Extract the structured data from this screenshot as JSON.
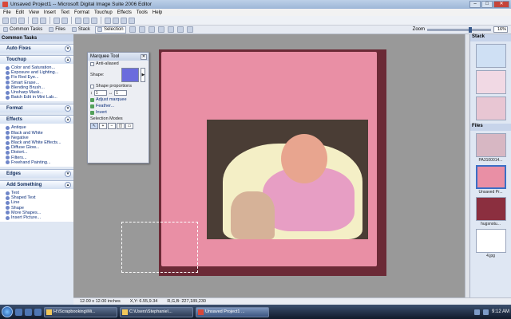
{
  "window": {
    "title": "Unsaved Project1 -- Microsoft Digital Image Suite 2006 Editor",
    "min": "–",
    "max": "□",
    "close": "✕"
  },
  "menu": [
    "File",
    "Edit",
    "View",
    "Insert",
    "Text",
    "Format",
    "Touchup",
    "Effects",
    "Tools",
    "Help"
  ],
  "pane_tabs": {
    "common_tasks": "Common Tasks",
    "files": "Files",
    "stack": "Stack",
    "selection": "Selection"
  },
  "zoom": {
    "label": "Zoom",
    "value": "16%"
  },
  "left_pane": {
    "header": "Common Tasks",
    "sections": [
      {
        "title": "Auto Fixes",
        "items": []
      },
      {
        "title": "Touchup",
        "items": [
          "Color and Saturation...",
          "Exposure and Lighting...",
          "Fix Red Eye...",
          "Smart Erase...",
          "Blending Brush...",
          "Unsharp Mask...",
          "Batch Edit in Mini Lab..."
        ]
      },
      {
        "title": "Format",
        "items": []
      },
      {
        "title": "Effects",
        "items": [
          "Antique",
          "Black and White",
          "Negative",
          "Black and White Effects...",
          "Diffuse Glow...",
          "Distort...",
          "Filters...",
          "Freehand Painting..."
        ]
      },
      {
        "title": "Edges",
        "items": []
      },
      {
        "title": "Add Something",
        "items": [
          "Text",
          "Shaped Text",
          "Line",
          "Shape",
          "More Shapes...",
          "Insert Picture..."
        ]
      }
    ]
  },
  "marquee_panel": {
    "title": "Marquee Tool",
    "anti_aliased": "Anti-aliased",
    "shape_label": "Shape:",
    "shape_proportions": "Shape proportions",
    "width_value": "1",
    "height_value": "1",
    "adjust_marquee": "Adjust marquee",
    "feather": "Feather...",
    "invert": "Invert",
    "selection_modes": "Selection Modes"
  },
  "right_pane": {
    "stack_header": "Stack",
    "files_header": "Files",
    "files": [
      {
        "label": "PA3100014..."
      },
      {
        "label": "Unsaved Pr..."
      },
      {
        "label": "hugsnotu..."
      },
      {
        "label": "4.jpg"
      }
    ]
  },
  "status": {
    "size": "12.00 x 12.00 inches",
    "xy": "X,Y: 6.55,9.34",
    "rgb": "R,G,B: 227,189,230"
  },
  "taskbar": {
    "buttons": [
      {
        "label": "H:\\Scrapbooking\\Mi...",
        "active": false
      },
      {
        "label": "C:\\Users\\Stephanie\\...",
        "active": false
      },
      {
        "label": "Unsaved Project1 ...",
        "active": true
      }
    ],
    "clock": "9:12 AM"
  },
  "colors": {
    "pink_paper": "#e98fa5",
    "frame": "#6b2a36",
    "workspace": "#999999"
  }
}
